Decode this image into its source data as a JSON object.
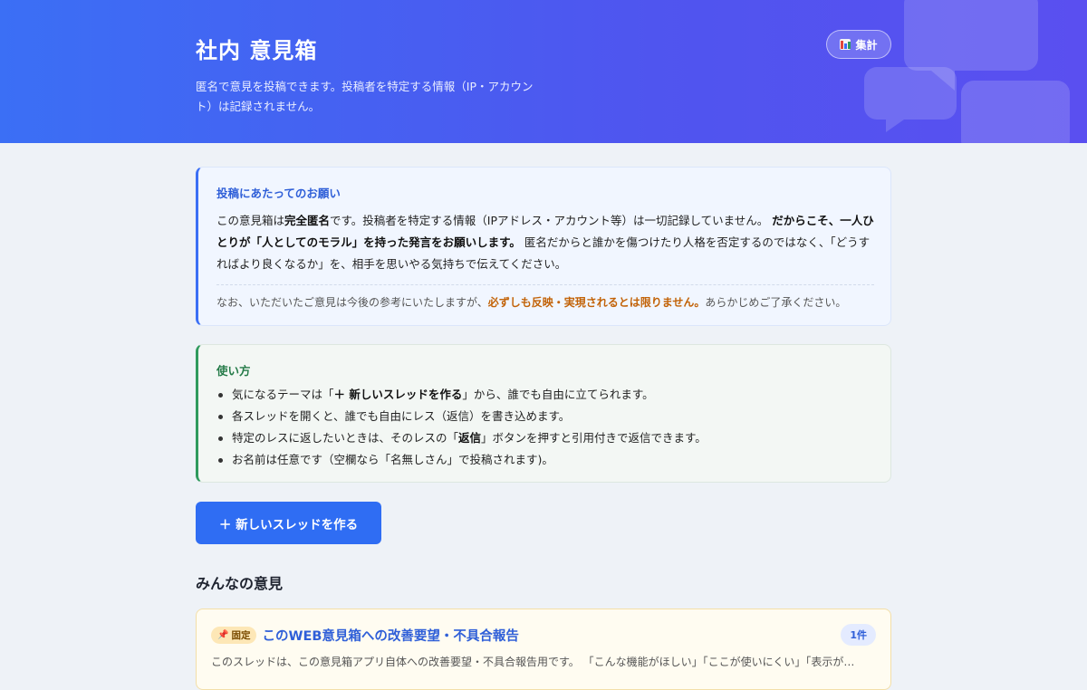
{
  "header": {
    "title": "社内 意見箱",
    "subtitle": "匿名で意見を投稿できます。投稿者を特定する情報（IP・アカウント）は記録されません。",
    "stats_button": {
      "label": "集計",
      "icon": "bar-chart-icon"
    }
  },
  "notice": {
    "title": "投稿にあたってのお願い",
    "p1_a": "この意見箱は",
    "p1_b": "完全匿名",
    "p1_c": "です。投稿者を特定する情報（IPアドレス・アカウント等）は一切記録していません。",
    "p1_d": "だからこそ、一人ひとりが「人としてのモラル」を持った発言をお願いします。",
    "p1_e": "匿名だからと誰かを傷つけたり人格を否定するのではなく、「どうすればより良くなるか」を、相手を思いやる気持ちで伝えてください。",
    "foot_a": "なお、いただいたご意見は今後の参考にいたしますが、",
    "foot_b": "必ずしも反映・実現されるとは限りません。",
    "foot_c": "あらかじめご了承ください。"
  },
  "howto": {
    "title": "使い方",
    "item1_a": "気になるテーマは「",
    "item1_b": "＋ 新しいスレッドを作る",
    "item1_c": "」から、誰でも自由に立てられます。",
    "item2": "各スレッドを開くと、誰でも自由にレス（返信）を書き込めます。",
    "item3_a": "特定のレスに返したいときは、そのレスの「",
    "item3_b": "返信",
    "item3_c": "」ボタンを押すと引用付きで返信できます。",
    "item4": "お名前は任意です（空欄なら「名無しさん」で投稿されます)。"
  },
  "new_thread_button": {
    "label": "＋ 新しいスレッドを作る"
  },
  "threads_section": {
    "title": "みんなの意見",
    "threads": [
      {
        "pinned_label": "固定",
        "title": "このWEB意見箱への改善要望・不具合報告",
        "count": "1件",
        "excerpt": "このスレッドは、この意見箱アプリ自体への改善要望・不具合報告用です。 「こんな機能がほしい」「ここが使いにくい」「表示が…"
      }
    ]
  },
  "colors": {
    "header_gradient_start": "#3b6ff5",
    "header_gradient_end": "#5a4ff0",
    "accent_blue": "#2f6df3",
    "notice_border": "#3b6ff5",
    "howto_border": "#2f9a5d",
    "warning_text": "#c26207"
  }
}
